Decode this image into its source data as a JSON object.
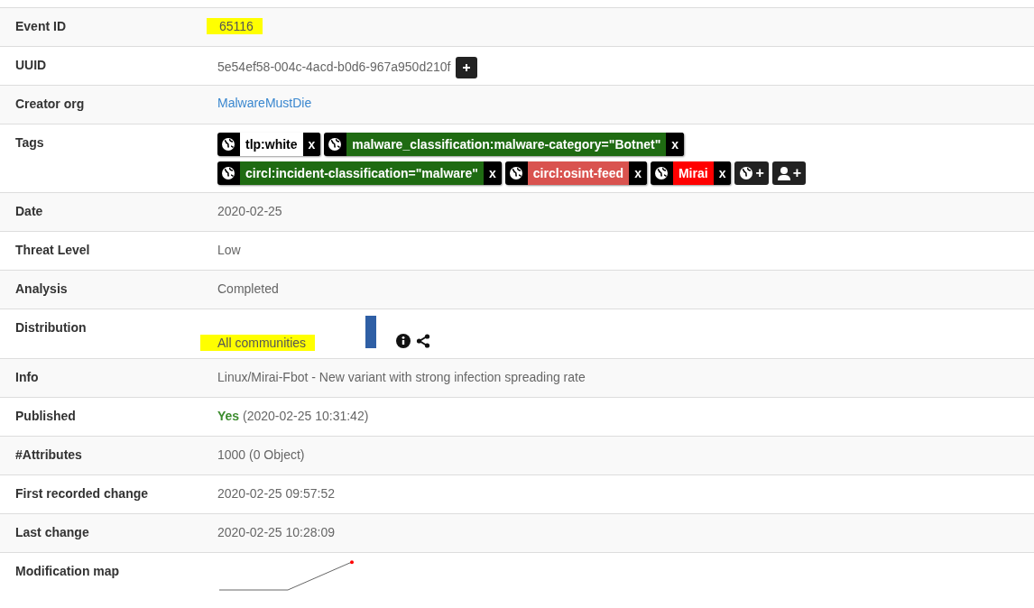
{
  "rows": [
    {
      "label": "Event ID",
      "kind": "highlight",
      "value": "65116"
    },
    {
      "label": "UUID",
      "kind": "uuid",
      "value": "5e54ef58-004c-4acd-b0d6-967a950d210f"
    },
    {
      "label": "Creator org",
      "kind": "link",
      "value": "MalwareMustDie"
    },
    {
      "label": "Tags",
      "kind": "tags",
      "tags": [
        {
          "label": "tlp:white",
          "color": "#ffffff",
          "remove": "x"
        },
        {
          "label": "malware_classification:malware-category=\"Botnet\"",
          "color": "#1f6b12",
          "remove": "x"
        },
        {
          "label": "circl:incident-classification=\"malware\"",
          "color": "#1f6b12",
          "remove": "x"
        },
        {
          "label": "circl:osint-feed",
          "color": "#d9534f",
          "remove": "x"
        },
        {
          "label": "Mirai",
          "color": "#ff0000",
          "remove": "x"
        }
      ],
      "add_buttons": [
        {
          "kind": "tag",
          "label": "+"
        },
        {
          "kind": "user",
          "label": "+"
        }
      ]
    },
    {
      "label": "Date",
      "kind": "text",
      "value": "2020-02-25"
    },
    {
      "label": "Threat Level",
      "kind": "text",
      "value": "Low"
    },
    {
      "label": "Analysis",
      "kind": "text",
      "value": "Completed"
    },
    {
      "label": "Distribution",
      "kind": "distribution",
      "value": "All communities"
    },
    {
      "label": "Info",
      "kind": "text",
      "value": "Linux/Mirai-Fbot - New variant with strong infection spreading rate"
    },
    {
      "label": "Published",
      "kind": "published",
      "value": "Yes",
      "detail": "(2020-02-25 10:31:42)"
    },
    {
      "label": "#Attributes",
      "kind": "text",
      "value": "1000 (0 Object)"
    },
    {
      "label": "First recorded change",
      "kind": "text",
      "value": "2020-02-25 09:57:52"
    },
    {
      "label": "Last change",
      "kind": "text",
      "value": "2020-02-25 10:28:09"
    },
    {
      "label": "Modification map",
      "kind": "map"
    }
  ]
}
